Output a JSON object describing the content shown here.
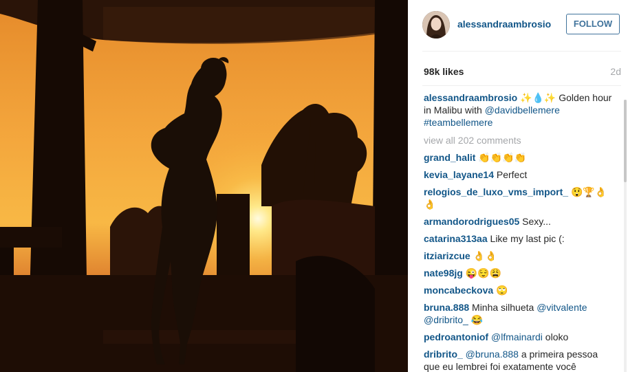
{
  "post": {
    "username": "alessandraambrosio",
    "follow_label": "FOLLOW",
    "likes": "98k likes",
    "age": "2d"
  },
  "caption": {
    "username": "alessandraambrosio",
    "emoji": "✨💧✨",
    "text": " Golden hour in Malibu with ",
    "mention": "@davidbellemere",
    "hashtag": "#teambellemere"
  },
  "view_all": "view all 202 comments",
  "comments": [
    {
      "user": "grand_halit",
      "parts": [
        {
          "t": "text",
          "v": " 👏👏👏👏"
        }
      ]
    },
    {
      "user": "kevia_layane14",
      "parts": [
        {
          "t": "text",
          "v": " Perfect"
        }
      ]
    },
    {
      "user": "relogios_de_luxo_vms_import_",
      "parts": [
        {
          "t": "text",
          "v": " 😲🏆👌 👌"
        }
      ]
    },
    {
      "user": "armandorodrigues05",
      "parts": [
        {
          "t": "text",
          "v": " Sexy..."
        }
      ]
    },
    {
      "user": "catarina313aa",
      "parts": [
        {
          "t": "text",
          "v": " Like my last pic (:"
        }
      ]
    },
    {
      "user": "itziarizcue",
      "parts": [
        {
          "t": "text",
          "v": " 👌👌"
        }
      ]
    },
    {
      "user": "nate98jg",
      "parts": [
        {
          "t": "text",
          "v": " 😜😌😩"
        }
      ]
    },
    {
      "user": "moncabeckova",
      "parts": [
        {
          "t": "text",
          "v": " 🙄"
        }
      ]
    },
    {
      "user": "bruna.888",
      "parts": [
        {
          "t": "text",
          "v": " Minha silhueta "
        },
        {
          "t": "mention",
          "v": "@vitvalente"
        },
        {
          "t": "text",
          "v": " "
        },
        {
          "t": "mention",
          "v": "@dribrito_"
        },
        {
          "t": "text",
          "v": " 😂"
        }
      ]
    },
    {
      "user": "pedroantoniof",
      "parts": [
        {
          "t": "text",
          "v": " "
        },
        {
          "t": "mention",
          "v": "@lfmainardi"
        },
        {
          "t": "text",
          "v": " oloko"
        }
      ]
    },
    {
      "user": "dribrito_",
      "parts": [
        {
          "t": "text",
          "v": " "
        },
        {
          "t": "mention",
          "v": "@bruna.888"
        },
        {
          "t": "text",
          "v": " a primeira pessoa que eu lembrei foi exatamente você"
        }
      ]
    }
  ],
  "colors": {
    "link": "#125688",
    "follow": "#3f729b",
    "muted": "#a5a7aa",
    "sunset_top": "#f6b43e",
    "sunset_glow": "#fff3b0",
    "silhouette": "#1a0e06"
  }
}
